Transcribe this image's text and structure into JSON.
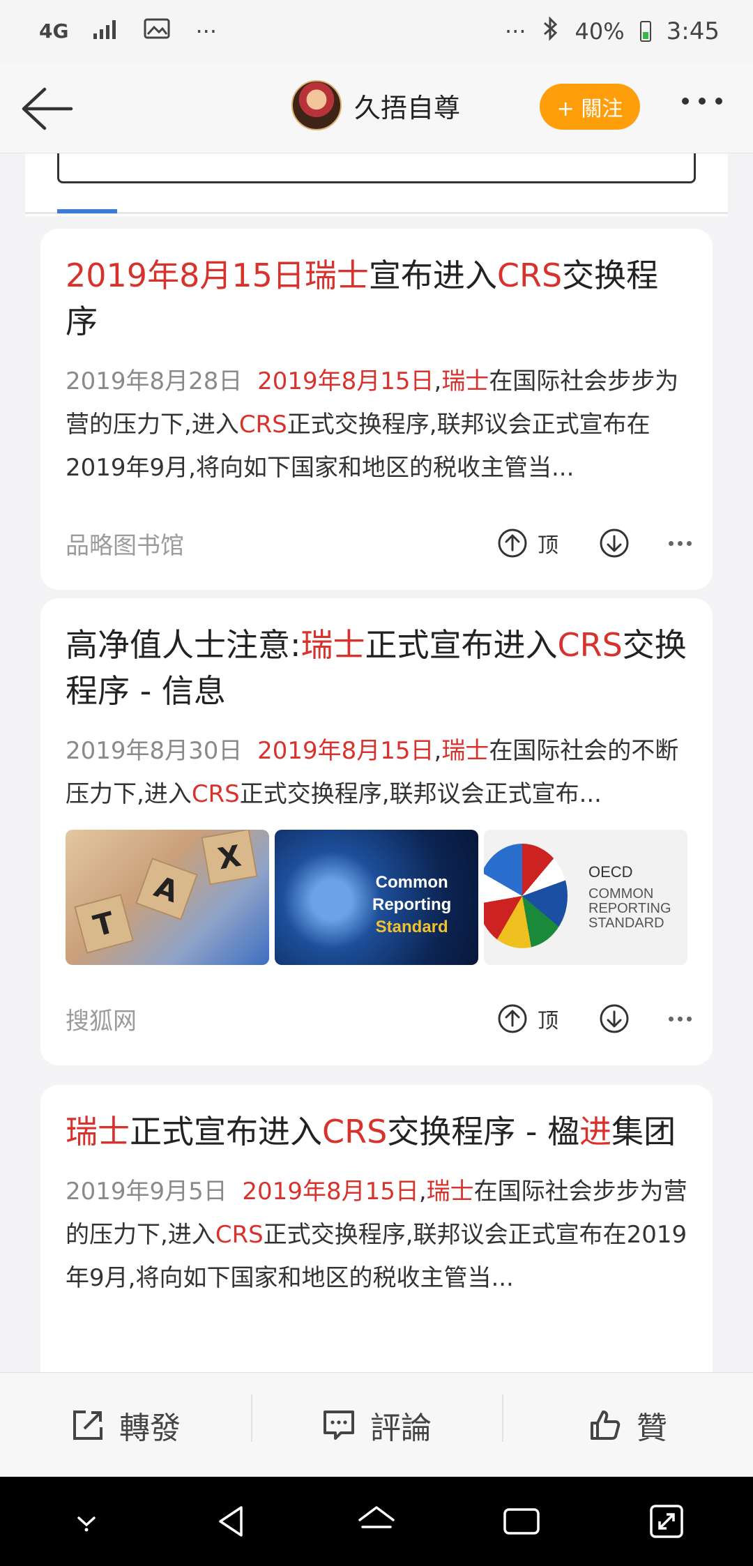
{
  "status_bar": {
    "network": "4G",
    "signal_icon": "signal-icon",
    "image_icon": "image-icon",
    "more": "···",
    "more_right": "···",
    "bluetooth_icon": "bluetooth-icon",
    "battery": "40%",
    "time": "3:45"
  },
  "header": {
    "profile_name": "久捂自尊",
    "follow_label": "+ 關注"
  },
  "results": [
    {
      "title": [
        {
          "text": "2019年8月15日",
          "hl": true
        },
        {
          "text": "瑞士",
          "hl": true
        },
        {
          "text": "宣布进入",
          "hl": false
        },
        {
          "text": "CRS",
          "hl": true
        },
        {
          "text": "交换程序",
          "hl": false
        }
      ],
      "date": "2019年8月28日",
      "snippet": [
        {
          "text": "2019年8月15日",
          "hl": true
        },
        {
          "text": ",",
          "hl": false
        },
        {
          "text": "瑞士",
          "hl": true
        },
        {
          "text": "在国际社会步步为营的压力下,进入",
          "hl": false
        },
        {
          "text": "CRS",
          "hl": true
        },
        {
          "text": "正式交换程序,联邦议会正式宣布在2019年9月,将向如下国家和地区的税收主管当...",
          "hl": false
        }
      ],
      "source": "品略图书馆",
      "ding": "顶"
    },
    {
      "title": [
        {
          "text": "高净值人士注意:",
          "hl": false
        },
        {
          "text": "瑞士",
          "hl": true
        },
        {
          "text": "正式宣布进入",
          "hl": false
        },
        {
          "text": "CRS",
          "hl": true
        },
        {
          "text": "交换程序 - 信息",
          "hl": false
        }
      ],
      "date": "2019年8月30日",
      "snippet": [
        {
          "text": "2019年8月15日",
          "hl": true
        },
        {
          "text": ",",
          "hl": false
        },
        {
          "text": "瑞士",
          "hl": true
        },
        {
          "text": "在国际社会的不断压力下,进入",
          "hl": false
        },
        {
          "text": "CRS",
          "hl": true
        },
        {
          "text": "正式交换程序,联邦议会正式宣布...",
          "hl": false
        }
      ],
      "thumbnails": {
        "tax_tiles": [
          "T",
          "A",
          "X"
        ],
        "crs_lines": [
          "Common",
          "Reporting",
          "Standard"
        ],
        "oecd_title": "OECD",
        "oecd_lines": [
          "COMMON",
          "REPORTING",
          "STANDARD"
        ]
      },
      "source": "搜狐网",
      "ding": "顶"
    },
    {
      "title": [
        {
          "text": "瑞士",
          "hl": true
        },
        {
          "text": "正式宣布进入",
          "hl": false
        },
        {
          "text": "CRS",
          "hl": true
        },
        {
          "text": "交换程序 - 楹",
          "hl": false
        },
        {
          "text": "进",
          "hl": true
        },
        {
          "text": "集团",
          "hl": false
        }
      ],
      "date": "2019年9月5日",
      "snippet": [
        {
          "text": "2019年8月15日",
          "hl": true
        },
        {
          "text": ",",
          "hl": false
        },
        {
          "text": "瑞士",
          "hl": true
        },
        {
          "text": "在国际社会步步为营的压力下,进入",
          "hl": false
        },
        {
          "text": "CRS",
          "hl": true
        },
        {
          "text": "正式交换程序,联邦议会正式宣布在2019年9月,将向如下国家和地区的税收主管当...",
          "hl": false
        }
      ]
    }
  ],
  "action_bar": {
    "share": "轉發",
    "comment": "評論",
    "like": "贊"
  },
  "colors": {
    "highlight": "#d8322d",
    "follow": "#ff9e0b",
    "accent": "#3a7bd5"
  }
}
